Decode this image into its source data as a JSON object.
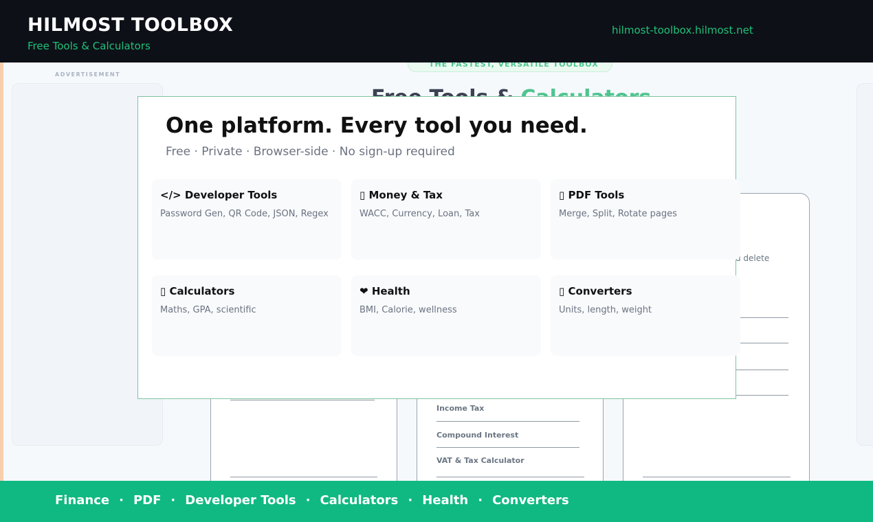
{
  "header": {
    "title": "HILMOST TOOLBOX",
    "subtitle": "Free Tools & Calculators",
    "url": "hilmost-toolbox.hilmost.net"
  },
  "background": {
    "ad_label": "ADVERTISEMENT",
    "badge_text": "THE FASTEST, VERSATILE TOOLBOX",
    "hero_title_part1": "Free Tools & ",
    "hero_title_part2": "Calculators",
    "partial_text": "u delete",
    "finance_links": [
      "Income Tax",
      "Compound Interest",
      "VAT & Tax Calculator"
    ]
  },
  "modal": {
    "title": "One platform. Every tool you need.",
    "subtitle": "Free · Private · Browser-side · No sign-up required",
    "cards": [
      {
        "icon": "</>",
        "name": "Developer Tools",
        "desc": "Password Gen, QR Code, JSON, Regex"
      },
      {
        "icon": "▯",
        "name": "Money & Tax",
        "desc": "WACC, Currency, Loan, Tax"
      },
      {
        "icon": "▯",
        "name": "PDF Tools",
        "desc": "Merge, Split, Rotate pages"
      },
      {
        "icon": "▯",
        "name": "Calculators",
        "desc": "Maths, GPA, scientific"
      },
      {
        "icon": "❤",
        "name": "Health",
        "desc": "BMI, Calorie, wellness"
      },
      {
        "icon": "▯",
        "name": "Converters",
        "desc": "Units, length, weight"
      }
    ]
  },
  "footer": {
    "links": [
      "Finance",
      "PDF",
      "Developer Tools",
      "Calculators",
      "Health",
      "Converters"
    ],
    "separator": "·"
  },
  "colors": {
    "header_bg": "#0d1117",
    "accent_green": "#22c07a",
    "footer_bg": "#10b981",
    "modal_border": "#7ec39f"
  }
}
